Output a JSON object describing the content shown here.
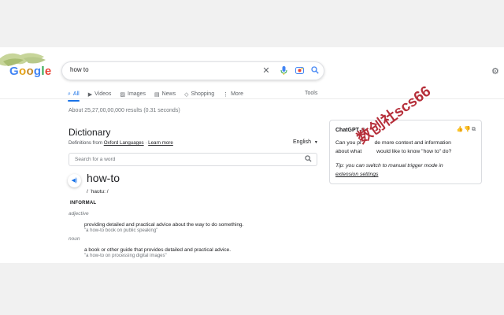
{
  "logo": "Google",
  "search": {
    "query": "how to"
  },
  "tabs": [
    {
      "label": "All",
      "icon": "search-icon"
    },
    {
      "label": "Videos",
      "icon": "video-icon"
    },
    {
      "label": "Images",
      "icon": "image-icon"
    },
    {
      "label": "News",
      "icon": "news-icon"
    },
    {
      "label": "Shopping",
      "icon": "tag-icon"
    },
    {
      "label": "More",
      "icon": "more-vertical-icon"
    }
  ],
  "tools_label": "Tools",
  "result_stats": "About 25,27,00,00,000 results (0.31 seconds)",
  "dictionary": {
    "title": "Dictionary",
    "source_prefix": "Definitions from",
    "source_link": "Oxford Languages",
    "separator": "·",
    "learn_more": "Learn more",
    "language": "English",
    "search_placeholder": "Search for a word",
    "headword": "how-to",
    "phonetic": "/ ˈhaʊtu: /",
    "register": "INFORMAL",
    "senses": [
      {
        "pos": "adjective",
        "definition": "providing detailed and practical advice about the way to do something.",
        "example": "\"a how-to book on public speaking\""
      },
      {
        "pos": "noun",
        "definition": "a book or other guide that provides detailed and practical advice.",
        "example": "\"a how-to on processing digital images\""
      }
    ]
  },
  "chatgpt": {
    "title": "ChatGPT",
    "body_line1": "Can you pl         de more context and information",
    "body_line2": "about what          would like to know \"how to\" do?",
    "tip_prefix": "Tip: you can switch to manual trigger mode in",
    "tip_link": "extension settings"
  },
  "watermark": "数创社scs66",
  "colors": {
    "accent": "#1a73e8",
    "watermark": "#b01e2a"
  }
}
